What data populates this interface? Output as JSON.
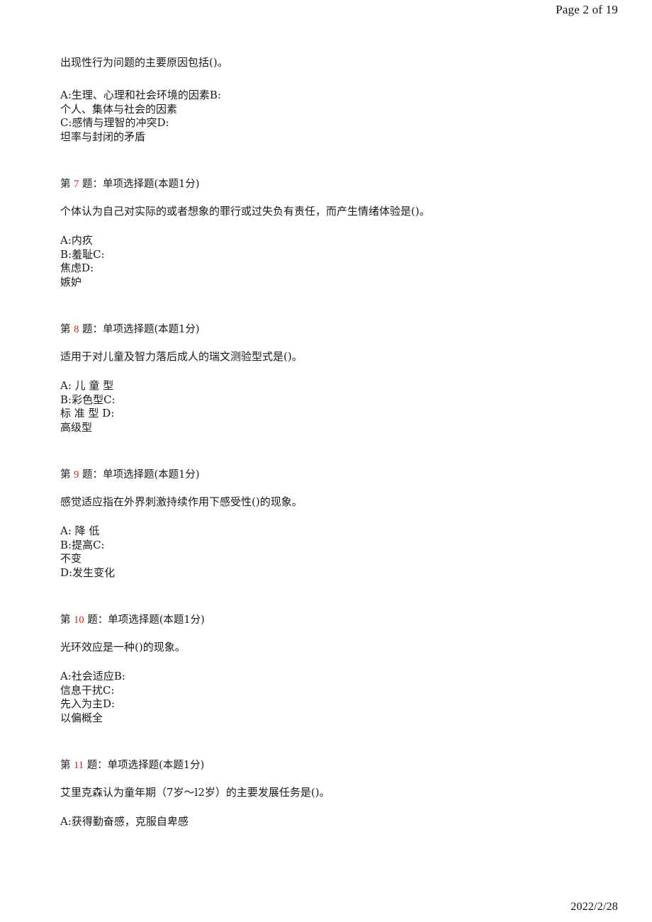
{
  "header": {
    "page_label": "Page 2 of 19"
  },
  "footer": {
    "date": "2022/2/28"
  },
  "blocks": [
    {
      "kind": "continuation",
      "stem": "出现性行为问题的主要原因包括()。",
      "options": [
        "A:生理、心理和社会环境的因素B:",
        "个人、集体与社会的因素",
        "C:感情与理智的冲突D:",
        "坦率与封闭的矛盾"
      ]
    },
    {
      "kind": "question",
      "header_prefix": "第",
      "number": "7",
      "header_suffix": "题：单项选择题(本题1分)",
      "stem": "个体认为自己对实际的或者想象的罪行或过失负有责任，而产生情绪体验是()。",
      "options": [
        "A:内疚",
        "B:羞耻C:",
        "焦虑D:",
        "嫉妒"
      ]
    },
    {
      "kind": "question",
      "header_prefix": "第",
      "number": "8",
      "header_suffix": "题：单项选择题(本题1分)",
      "stem": "适用于对儿童及智力落后成人的瑞文测验型式是()。",
      "options": [
        "A: 儿 童 型",
        "B:彩色型C:",
        "标 准 型 D:",
        "高级型"
      ]
    },
    {
      "kind": "question",
      "header_prefix": "第",
      "number": "9",
      "header_suffix": "题：单项选择题(本题1分)",
      "stem": "感觉适应指在外界刺激持续作用下感受性()的现象。",
      "options": [
        "A: 降 低",
        "B:提高C:",
        "不变",
        "D:发生变化"
      ]
    },
    {
      "kind": "question",
      "header_prefix": "第",
      "number": "10",
      "header_suffix": "题：单项选择题(本题1分)",
      "stem": "光环效应是一种()的现象。",
      "options": [
        "A:社会适应B:",
        "信息干扰C:",
        "先入为主D:",
        "以偏概全"
      ]
    },
    {
      "kind": "question",
      "header_prefix": "第",
      "number": "11",
      "header_suffix": "题：单项选择题(本题1分)",
      "stem": "艾里克森认为童年期（7岁～l2岁）的主要发展任务是()。",
      "options": [
        "A:获得勤奋感，克服自卑感"
      ]
    }
  ]
}
